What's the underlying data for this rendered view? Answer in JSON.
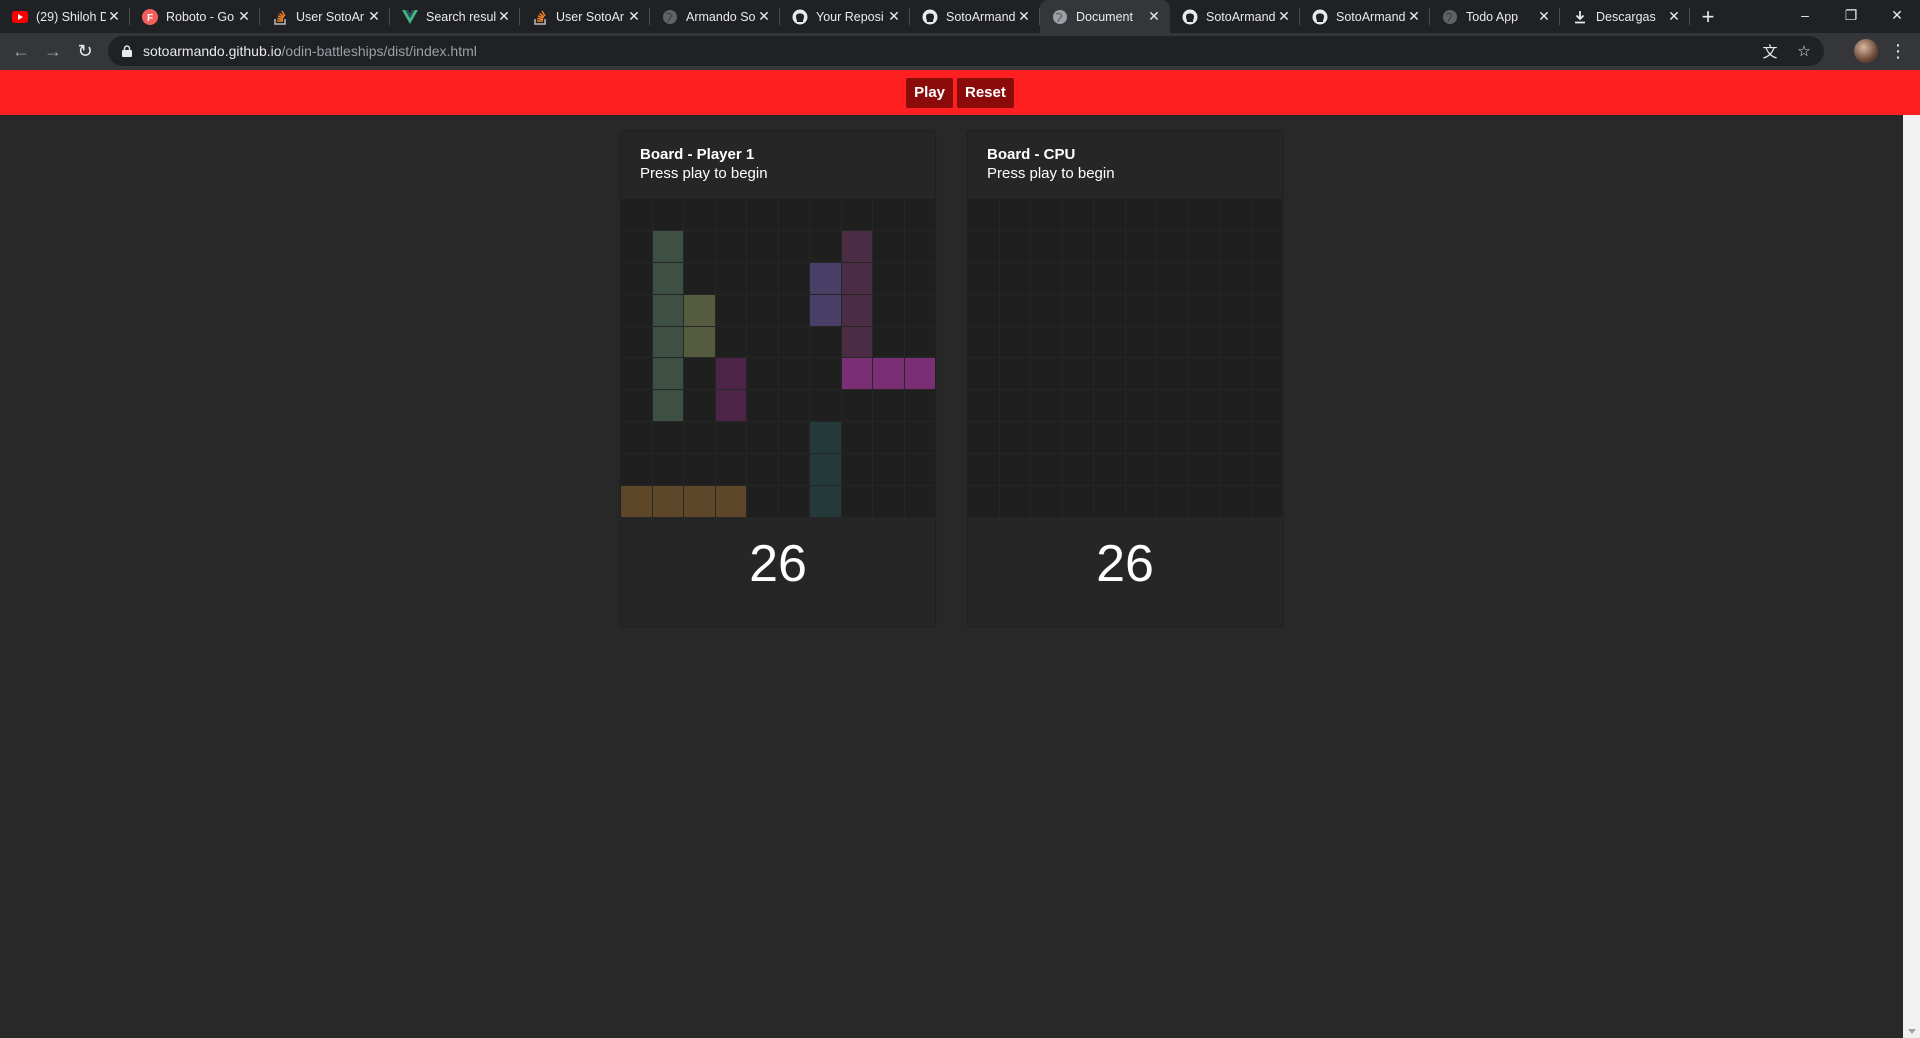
{
  "browser": {
    "tabs": [
      {
        "title": "(29) Shiloh D",
        "icon": "youtube-icon",
        "color": "#ff0000",
        "active": false
      },
      {
        "title": "Roboto - Go",
        "icon": "google-fonts-icon",
        "color": "#f25f5c",
        "active": false
      },
      {
        "title": "User SotoAr",
        "icon": "stackoverflow-icon",
        "color": "#f48024",
        "active": false
      },
      {
        "title": "Search resul",
        "icon": "vue-icon",
        "color": "#41b883",
        "active": false
      },
      {
        "title": "User SotoAr",
        "icon": "stackoverflow-icon",
        "color": "#f48024",
        "active": false
      },
      {
        "title": "Armando So",
        "icon": "globe-icon",
        "color": "#5f6368",
        "active": false
      },
      {
        "title": "Your Reposi",
        "icon": "github-icon",
        "color": "#e8eaed",
        "active": false
      },
      {
        "title": "SotoArmand",
        "icon": "github-icon",
        "color": "#e8eaed",
        "active": false
      },
      {
        "title": "Document",
        "icon": "globe-icon",
        "color": "#9aa0a6",
        "active": true
      },
      {
        "title": "SotoArmand",
        "icon": "github-icon",
        "color": "#e8eaed",
        "active": false
      },
      {
        "title": "SotoArmand",
        "icon": "github-icon",
        "color": "#e8eaed",
        "active": false
      },
      {
        "title": "Todo App",
        "icon": "globe-icon",
        "color": "#5f6368",
        "active": false
      },
      {
        "title": "Descargas",
        "icon": "download-icon",
        "color": "#e8eaed",
        "active": false
      }
    ],
    "url_host": "sotoarmando.github.io",
    "url_path": "/odin-battleships/dist/index.html"
  },
  "header": {
    "play_label": "Play",
    "reset_label": "Reset"
  },
  "boards": [
    {
      "title": "Board - Player 1",
      "status": "Press play to begin",
      "score": "26",
      "ships": [
        {
          "color": "#3e4f44",
          "cells": [
            [
              1,
              1
            ],
            [
              2,
              1
            ],
            [
              3,
              1
            ],
            [
              4,
              1
            ],
            [
              5,
              1
            ],
            [
              6,
              1
            ]
          ]
        },
        {
          "color": "#545b3e",
          "cells": [
            [
              3,
              2
            ],
            [
              4,
              2
            ]
          ]
        },
        {
          "color": "#4b2447",
          "cells": [
            [
              5,
              3
            ],
            [
              6,
              3
            ]
          ]
        },
        {
          "color": "#4a3f66",
          "cells": [
            [
              2,
              6
            ],
            [
              3,
              6
            ]
          ]
        },
        {
          "color": "#4a2c45",
          "cells": [
            [
              1,
              7
            ],
            [
              2,
              7
            ],
            [
              3,
              7
            ],
            [
              4,
              7
            ]
          ]
        },
        {
          "color": "#7a2e73",
          "cells": [
            [
              5,
              7
            ],
            [
              5,
              8
            ],
            [
              5,
              9
            ]
          ]
        },
        {
          "color": "#23393a",
          "cells": [
            [
              7,
              6
            ],
            [
              8,
              6
            ],
            [
              9,
              6
            ]
          ]
        },
        {
          "color": "#5e4628",
          "cells": [
            [
              9,
              0
            ],
            [
              9,
              1
            ],
            [
              9,
              2
            ],
            [
              9,
              3
            ]
          ]
        }
      ]
    },
    {
      "title": "Board - CPU",
      "status": "Press play to begin",
      "score": "26",
      "ships": []
    }
  ]
}
